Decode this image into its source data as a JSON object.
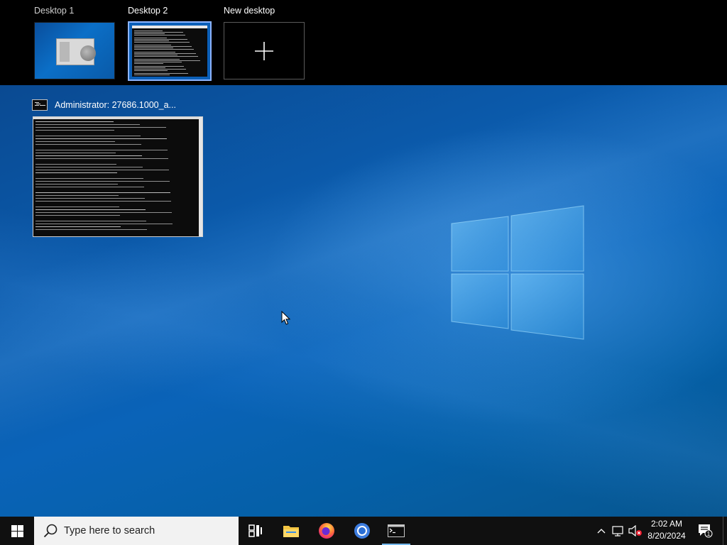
{
  "virtual_desktops": [
    {
      "label": "Desktop 1",
      "active": false
    },
    {
      "label": "Desktop 2",
      "active": true
    },
    {
      "label": "New desktop",
      "icon": "plus-icon"
    }
  ],
  "task_view_window": {
    "title": "Administrator:  27686.1000_a...",
    "app_icon": "command-prompt-icon"
  },
  "taskbar": {
    "search_placeholder": "Type here to search",
    "pinned_apps": [
      {
        "name": "Task View",
        "icon": "task-view-icon"
      },
      {
        "name": "File Explorer",
        "icon": "folder-icon"
      },
      {
        "name": "Firefox",
        "icon": "firefox-icon"
      },
      {
        "name": "Chrome",
        "icon": "chrome-icon"
      },
      {
        "name": "Command Prompt",
        "icon": "command-prompt-icon",
        "running": true
      }
    ],
    "clock_time": "2:02 AM",
    "clock_date": "8/20/2024",
    "notification_count": "1"
  },
  "colors": {
    "accent": "#76b9ed",
    "selected_desktop_border": "#8cb4ff",
    "taskbar": "#101010"
  }
}
